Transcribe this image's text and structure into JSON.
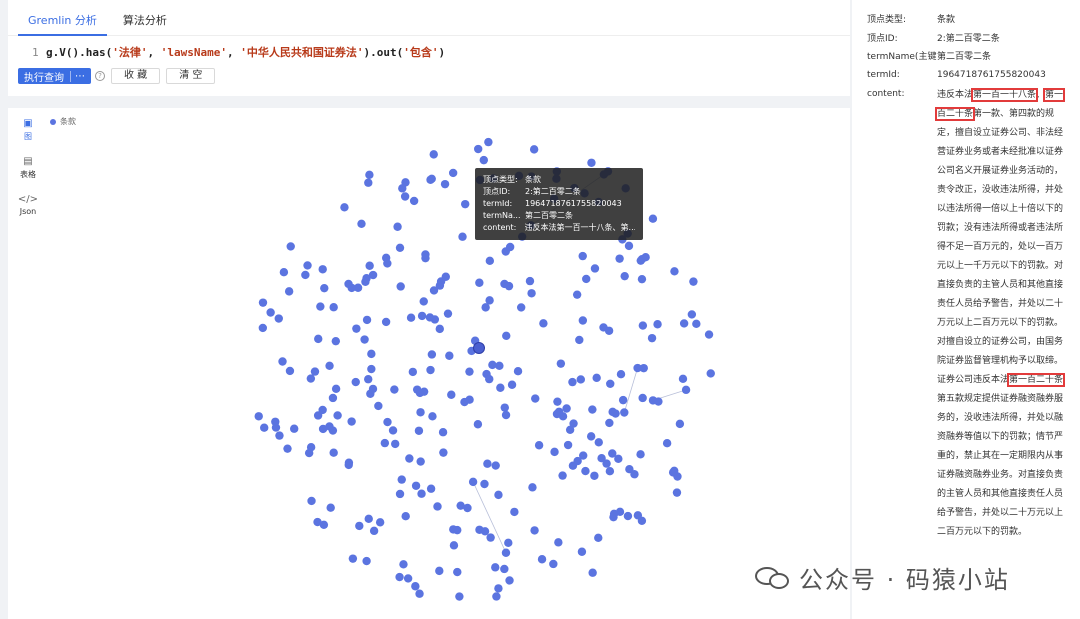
{
  "tabs": [
    {
      "label": "Gremlin 分析",
      "active": true
    },
    {
      "label": "算法分析",
      "active": false
    }
  ],
  "editor": {
    "line_number": "1",
    "code_prefix": "g.V().has(",
    "arg1": "'法律'",
    "sep1": ", ",
    "arg2": "'lawsName'",
    "sep2": ", ",
    "arg3": "'中华人民共和国证券法'",
    "code_mid": ").out(",
    "arg4": "'包含'",
    "code_suffix": ")"
  },
  "toolbar": {
    "run_label": "执行查询",
    "run_more": "⋯",
    "help": "?",
    "favorite_label": "收 藏",
    "clear_label": "清 空"
  },
  "view_tools": [
    {
      "icon": "▣",
      "label": "图",
      "active": true
    },
    {
      "icon": "▤",
      "label": "表格",
      "active": false
    },
    {
      "icon": "</>",
      "label": "Json",
      "active": false
    }
  ],
  "legend": {
    "label": "条款"
  },
  "tooltip": {
    "rows": [
      {
        "k": "顶点类型:",
        "v": "条款"
      },
      {
        "k": "顶点ID:",
        "v": "2:第二百零二条"
      },
      {
        "k": "termId:",
        "v": "1964718761755820043"
      },
      {
        "k": "termNa...",
        "v": "第二百零二条"
      },
      {
        "k": "content:",
        "v": "违反本法第一百一十八条、第..."
      }
    ]
  },
  "detail": {
    "rows": [
      {
        "k": "顶点类型:",
        "v": "条款"
      },
      {
        "k": "顶点ID:",
        "v": "2:第二百零二条"
      },
      {
        "k": "termName(主键...",
        "v": "第二百零二条"
      },
      {
        "k": "termId:",
        "v": "1964718761755820043"
      }
    ],
    "content_key": "content:",
    "content_parts": [
      {
        "t": "违反本法",
        "hl": false
      },
      {
        "t": "第一百一十八条",
        "hl": true
      },
      {
        "t": "、",
        "hl": false
      },
      {
        "t": "第一百二十条",
        "hl": true
      },
      {
        "t": "第一款、第四款的规定，擅自设立证券公司、非法经营证券业务或者未经批准以证券公司名义开展证券业务活动的，责令改正，没收违法所得，并处以违法所得一倍以上十倍以下的罚款；没有违法所得或者违法所得不足一百万元的，处以一百万元以上一千万元以下的罚款。对直接负责的主管人员和其他直接责任人员给予警告，并处以二十万元以上二百万元以下的罚款。对擅自设立的证券公司，由国务院证券监督管理机构予以取缔。证券公司违反本法",
        "hl": false
      },
      {
        "t": "第一百二十条",
        "hl": true
      },
      {
        "t": "第五款规定提供证券融资融券服务的，没收违法所得，并处以融资融券等值以下的罚款；情节严重的，禁止其在一定期限内从事证券融资融券业务。对直接负责的主管人员和其他直接责任人员给予警告，并处以二十万元以上二百万元以下的罚款。",
        "hl": false
      }
    ]
  },
  "watermark": {
    "text": "公众号 · 码猿小站"
  },
  "colors": {
    "accent": "#3b6ee3",
    "node": "#5b74e0",
    "highlight": "#e23b3b"
  }
}
